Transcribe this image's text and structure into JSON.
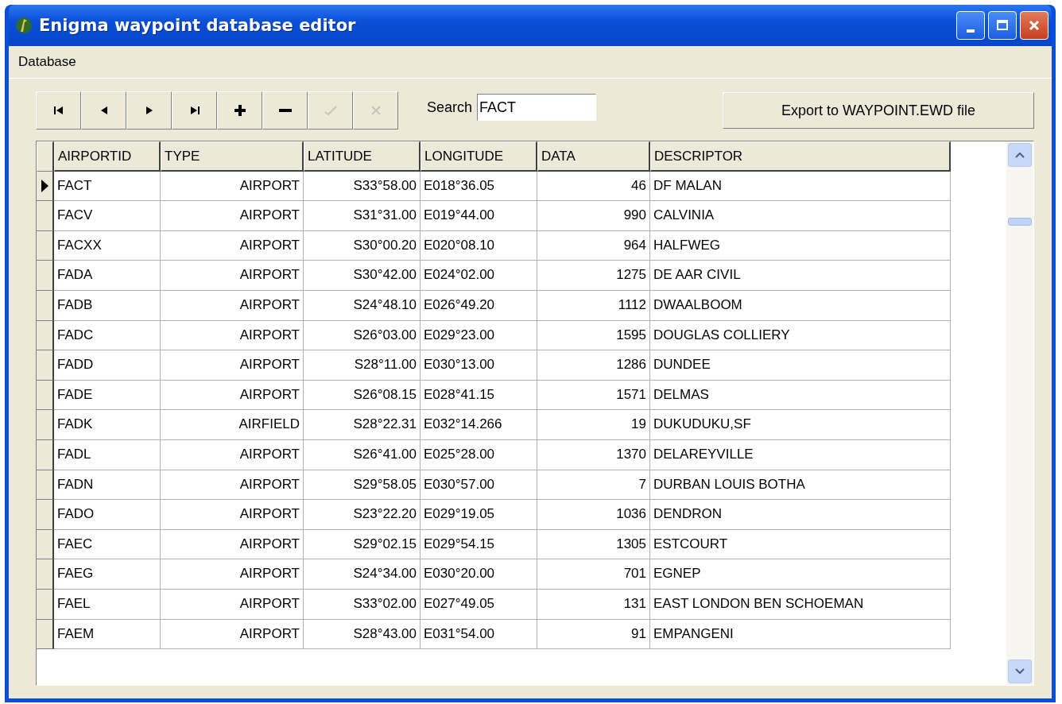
{
  "window": {
    "title": "Enigma waypoint database editor"
  },
  "menu": [
    {
      "label": "Database"
    }
  ],
  "navigator": [
    {
      "kind": "first",
      "disabled": false
    },
    {
      "kind": "prior",
      "disabled": false
    },
    {
      "kind": "next",
      "disabled": false
    },
    {
      "kind": "last",
      "disabled": false
    },
    {
      "kind": "insert",
      "disabled": false
    },
    {
      "kind": "delete",
      "disabled": false
    },
    {
      "kind": "post",
      "disabled": true
    },
    {
      "kind": "cancel",
      "disabled": true
    }
  ],
  "search": {
    "label": "Search",
    "value": "FACT"
  },
  "export_button": "Export to WAYPOINT.EWD file",
  "table": {
    "columns": [
      "AIRPORTID",
      "TYPE",
      "LATITUDE",
      "LONGITUDE",
      "DATA",
      "DESCRIPTOR"
    ],
    "rows": [
      {
        "selected": true,
        "cells": [
          "FACT",
          "AIRPORT",
          "S33°58.00",
          "E018°36.05",
          "46",
          "DF MALAN"
        ]
      },
      {
        "selected": false,
        "cells": [
          "FACV",
          "AIRPORT",
          "S31°31.00",
          "E019°44.00",
          "990",
          "CALVINIA"
        ]
      },
      {
        "selected": false,
        "cells": [
          "FACXX",
          "AIRPORT",
          "S30°00.20",
          "E020°08.10",
          "964",
          "HALFWEG"
        ]
      },
      {
        "selected": false,
        "cells": [
          "FADA",
          "AIRPORT",
          "S30°42.00",
          "E024°02.00",
          "1275",
          "DE AAR CIVIL"
        ]
      },
      {
        "selected": false,
        "cells": [
          "FADB",
          "AIRPORT",
          "S24°48.10",
          "E026°49.20",
          "1112",
          "DWAALBOOM"
        ]
      },
      {
        "selected": false,
        "cells": [
          "FADC",
          "AIRPORT",
          "S26°03.00",
          "E029°23.00",
          "1595",
          "DOUGLAS COLLIERY"
        ]
      },
      {
        "selected": false,
        "cells": [
          "FADD",
          "AIRPORT",
          "S28°11.00",
          "E030°13.00",
          "1286",
          "DUNDEE"
        ]
      },
      {
        "selected": false,
        "cells": [
          "FADE",
          "AIRPORT",
          "S26°08.15",
          "E028°41.15",
          "1571",
          "DELMAS"
        ]
      },
      {
        "selected": false,
        "cells": [
          "FADK",
          "AIRFIELD",
          "S28°22.31",
          "E032°14.266",
          "19",
          "DUKUDUKU,SF"
        ]
      },
      {
        "selected": false,
        "cells": [
          "FADL",
          "AIRPORT",
          "S26°41.00",
          "E025°28.00",
          "1370",
          "DELAREYVILLE"
        ]
      },
      {
        "selected": false,
        "cells": [
          "FADN",
          "AIRPORT",
          "S29°58.05",
          "E030°57.00",
          "7",
          "DURBAN LOUIS BOTHA"
        ]
      },
      {
        "selected": false,
        "cells": [
          "FADO",
          "AIRPORT",
          "S23°22.20",
          "E029°19.05",
          "1036",
          "DENDRON"
        ]
      },
      {
        "selected": false,
        "cells": [
          "FAEC",
          "AIRPORT",
          "S29°02.15",
          "E029°54.15",
          "1305",
          "ESTCOURT"
        ]
      },
      {
        "selected": false,
        "cells": [
          "FAEG",
          "AIRPORT",
          "S24°34.00",
          "E030°20.00",
          "701",
          "EGNEP"
        ]
      },
      {
        "selected": false,
        "cells": [
          "FAEL",
          "AIRPORT",
          "S33°02.00",
          "E027°49.05",
          "131",
          "EAST LONDON BEN SCHOEMAN"
        ]
      },
      {
        "selected": false,
        "cells": [
          "FAEM",
          "AIRPORT",
          "S28°43.00",
          "E031°54.00",
          "91",
          "EMPANGENI"
        ]
      }
    ]
  }
}
